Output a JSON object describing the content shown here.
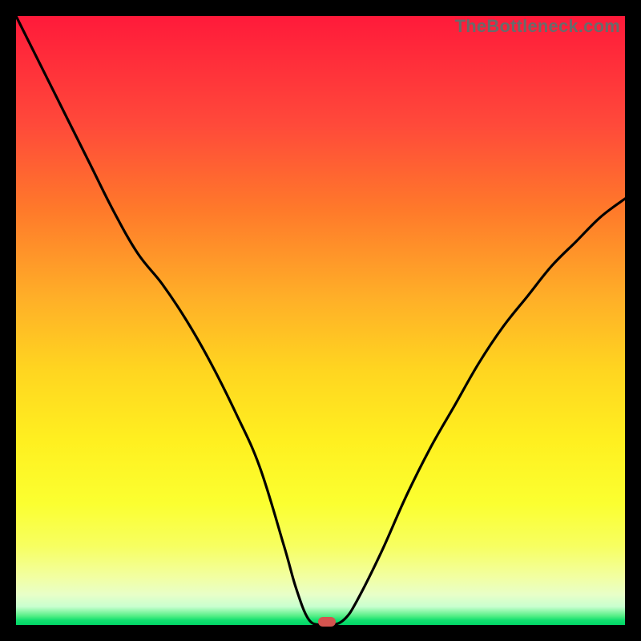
{
  "watermark": "TheBottleneck.com",
  "colors": {
    "background": "#000000",
    "curve": "#000000",
    "marker": "#d4544f",
    "gradient_top": "#ff1a3a",
    "gradient_bottom": "#00d666"
  },
  "chart_data": {
    "type": "line",
    "title": "",
    "xlabel": "",
    "ylabel": "",
    "xlim": [
      0,
      100
    ],
    "ylim": [
      0,
      100
    ],
    "x": [
      0,
      4,
      8,
      12,
      16,
      20,
      24,
      28,
      32,
      36,
      40,
      44,
      46,
      48,
      50,
      52,
      54,
      56,
      60,
      64,
      68,
      72,
      76,
      80,
      84,
      88,
      92,
      96,
      100
    ],
    "values": [
      100,
      92,
      84,
      76,
      68,
      61,
      56,
      50,
      43,
      35,
      26,
      13,
      6,
      1,
      0,
      0,
      1,
      4,
      12,
      21,
      29,
      36,
      43,
      49,
      54,
      59,
      63,
      67,
      70
    ],
    "marker": {
      "x": 51,
      "y": 0
    },
    "notes": "Vertical axis reads as bottleneck severity (low=good=green). Values are visually estimated from the curve relative to the plot box as percentages of height from bottom.",
    "segments_description": {
      "left": "Steep descent from top-left to the basin; slight inflection around x≈20 where slope becomes a bit steeper.",
      "basin": "Flat segment roughly from x≈48 to x≈53 at y≈0.",
      "right": "Smooth concave rise from basin toward top-right, leveling around y≈70 at x=100."
    }
  }
}
